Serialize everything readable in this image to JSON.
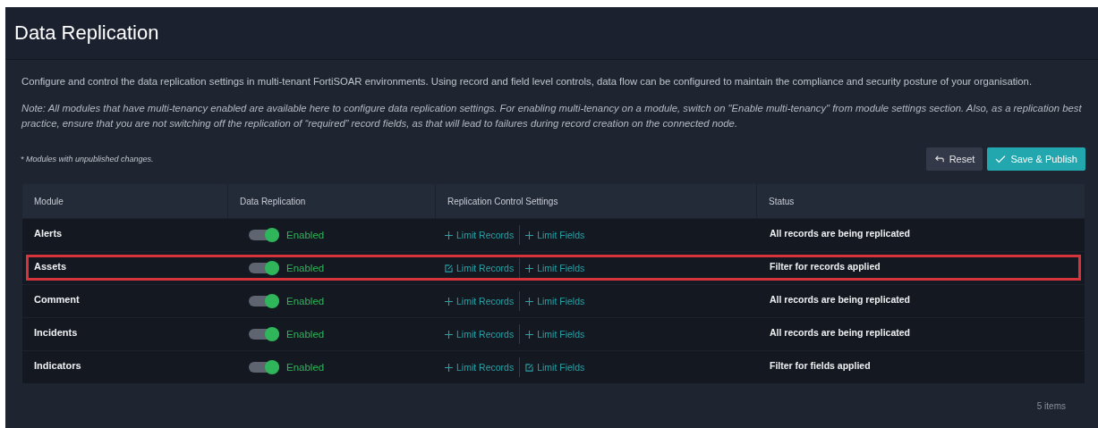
{
  "page": {
    "title": "Data Replication",
    "description": "Configure and control the data replication settings in multi-tenant FortiSOAR environments. Using record and field level controls, data flow can be configured to maintain the compliance and security posture of your organisation.",
    "note": "Note: All modules that have multi-tenancy enabled are available here to configure data replication settings. For enabling multi-tenancy on a module, switch on \"Enable multi-tenancy\" from module settings section. Also, as a replication best practice, ensure that you are not switching off the replication of “required” record fields, as that will lead to failures during record creation on the connected node.",
    "legend": "* Modules with unpublished changes.",
    "buttons": [
      {
        "label": "Reset",
        "kind": "reset"
      },
      {
        "label": "Save & Publish",
        "kind": "publish"
      }
    ]
  },
  "table": {
    "columns": [
      "Module",
      "Data Replication",
      "Replication Control Settings",
      "Status"
    ],
    "rows": [
      {
        "module": "Alerts",
        "replication_on": true,
        "replication_label": "Enabled",
        "records": {
          "label": "Limit Records",
          "kind": "add"
        },
        "fields": {
          "label": "Limit Fields",
          "kind": "add"
        },
        "status": "All records are being replicated",
        "highlighted": false
      },
      {
        "module": "Assets",
        "replication_on": true,
        "replication_label": "Enabled",
        "records": {
          "label": "Limit Records",
          "kind": "edit"
        },
        "fields": {
          "label": "Limit Fields",
          "kind": "add"
        },
        "status": "Filter for records applied",
        "highlighted": true
      },
      {
        "module": "Comment",
        "replication_on": true,
        "replication_label": "Enabled",
        "records": {
          "label": "Limit Records",
          "kind": "add"
        },
        "fields": {
          "label": "Limit Fields",
          "kind": "add"
        },
        "status": "All records are being replicated",
        "highlighted": false
      },
      {
        "module": "Incidents",
        "replication_on": true,
        "replication_label": "Enabled",
        "records": {
          "label": "Limit Records",
          "kind": "add"
        },
        "fields": {
          "label": "Limit Fields",
          "kind": "add"
        },
        "status": "All records are being replicated",
        "highlighted": false
      },
      {
        "module": "Indicators",
        "replication_on": true,
        "replication_label": "Enabled",
        "records": {
          "label": "Limit Records",
          "kind": "add"
        },
        "fields": {
          "label": "Limit Fields",
          "kind": "edit"
        },
        "status": "Filter for fields applied",
        "highlighted": false
      }
    ],
    "footer": "5 items"
  }
}
